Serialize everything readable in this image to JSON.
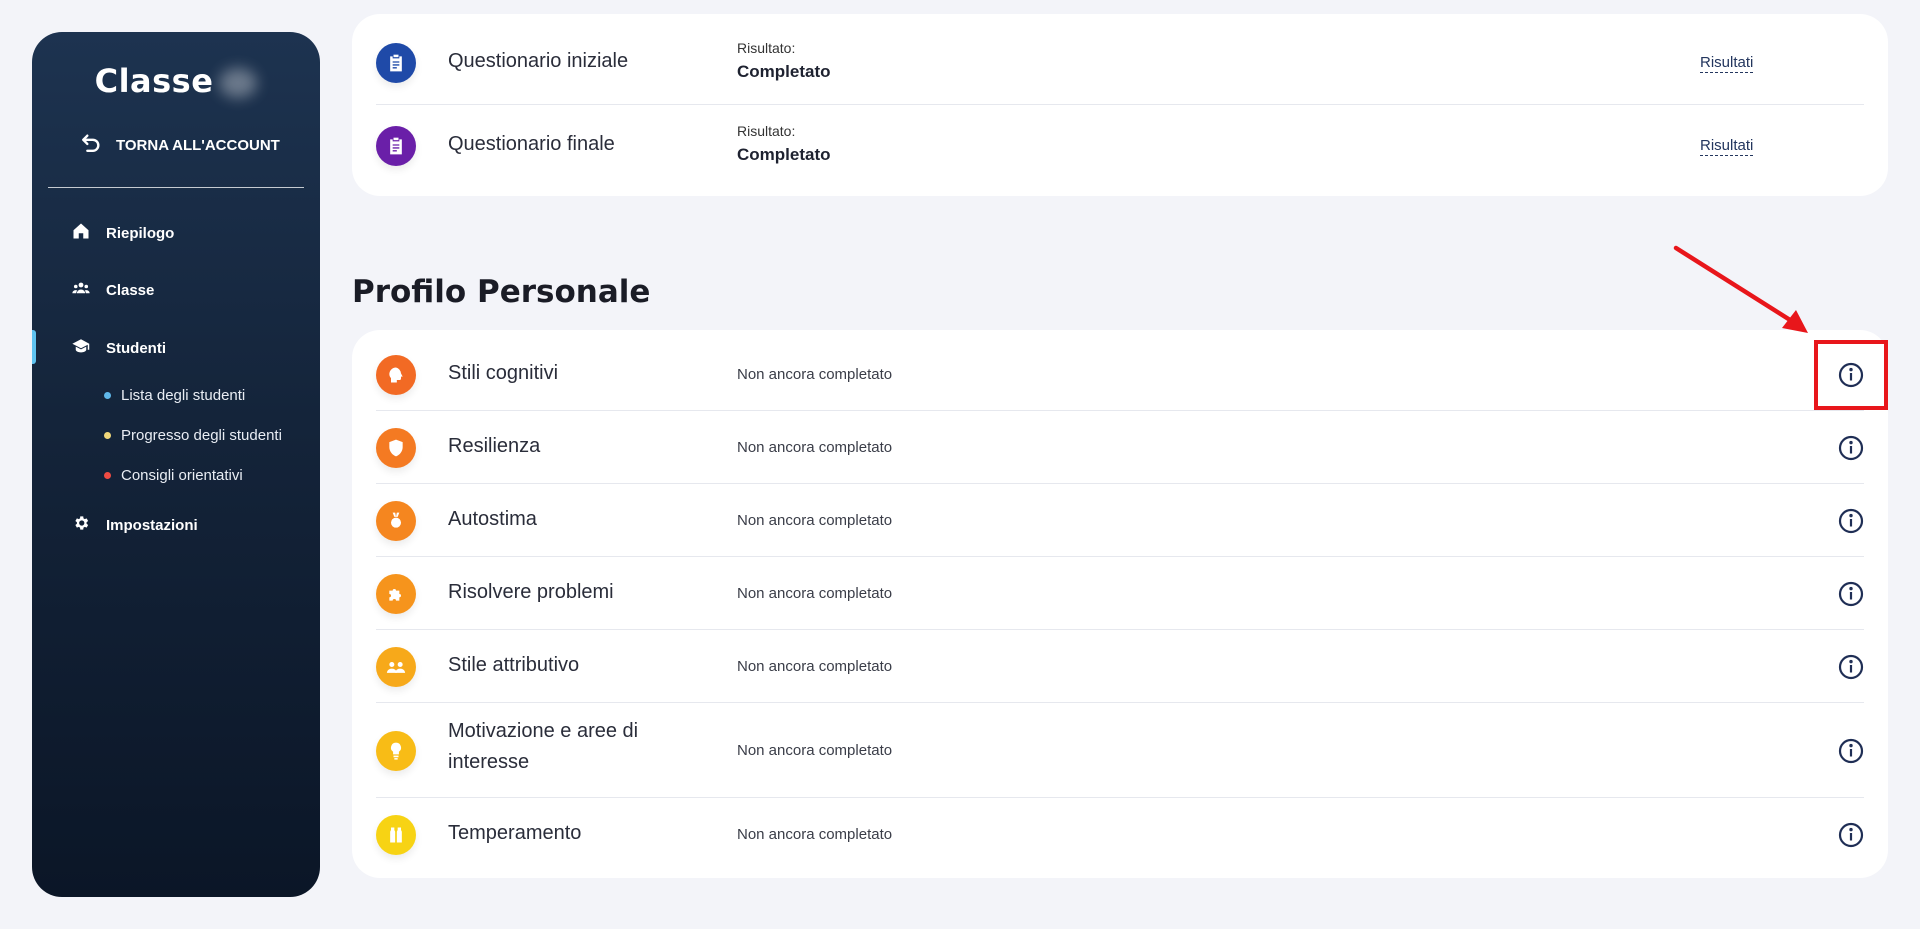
{
  "sidebar": {
    "brand": "Classe",
    "back_label": "TORNA ALL'ACCOUNT",
    "nav": {
      "riepilogo": "Riepilogo",
      "classe": "Classe",
      "studenti": "Studenti",
      "impostazioni": "Impostazioni"
    },
    "sub": {
      "lista": "Lista degli studenti",
      "progresso": "Progresso degli studenti",
      "consigli": "Consigli orientativi"
    },
    "dot_colors": [
      "#5fb8ea",
      "#f0d77a",
      "#ef4b43"
    ]
  },
  "questionnaires": [
    {
      "title": "Questionario iniziale",
      "result_label": "Risultato:",
      "result_value": "Completato",
      "link": "Risultati",
      "color": "#1f4aa8"
    },
    {
      "title": "Questionario finale",
      "result_label": "Risultato:",
      "result_value": "Completato",
      "link": "Risultati",
      "color": "#6a1fa8"
    }
  ],
  "profile": {
    "section_title": "Profilo Personale",
    "rows": [
      {
        "title": "Stili cognitivi",
        "status": "Non ancora completato",
        "color": "#f26a24",
        "icon": "brain-icon"
      },
      {
        "title": "Resilienza",
        "status": "Non ancora completato",
        "color": "#f47a22",
        "icon": "shield-icon"
      },
      {
        "title": "Autostima",
        "status": "Non ancora completato",
        "color": "#f5861f",
        "icon": "medal-icon"
      },
      {
        "title": "Risolvere problemi",
        "status": "Non ancora completato",
        "color": "#f6941c",
        "icon": "puzzle-icon"
      },
      {
        "title": "Stile attributivo",
        "status": "Non ancora completato",
        "color": "#f7a91a",
        "icon": "people-icon"
      },
      {
        "title": "Motivazione e aree di interesse",
        "status": "Non ancora completato",
        "color": "#f8bc16",
        "icon": "lightbulb-icon"
      },
      {
        "title": "Temperamento",
        "status": "Non ancora completato",
        "color": "#f7d314",
        "icon": "bottles-icon"
      }
    ]
  },
  "colors": {
    "annotation": "#e8161b",
    "accent": "#23365e"
  }
}
